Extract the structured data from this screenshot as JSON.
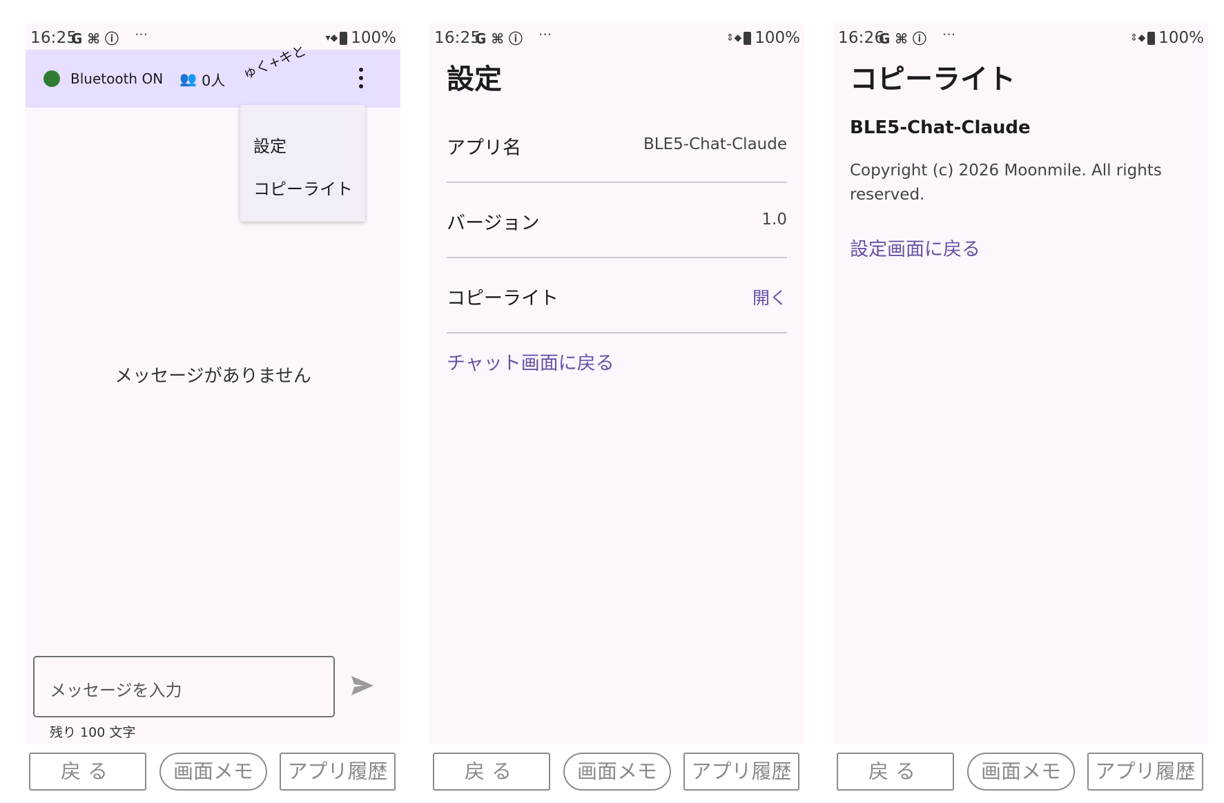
{
  "status_bars": [
    {
      "time": "16:25",
      "icons": "G ⌘ ⓘ",
      "dots": "···",
      "battery": "100%"
    },
    {
      "time": "16:25",
      "icons": "G ⌘ ⓘ",
      "dots": "···",
      "battery": "100%"
    },
    {
      "time": "16:26",
      "icons": "G ⌘ ⓘ",
      "dots": "···",
      "battery": "100%"
    }
  ],
  "chat": {
    "bluetooth_label": "Bluetooth ON",
    "bluetooth_color": "#2e7d32",
    "user_count": "0人",
    "scribble": "ゅく+キと",
    "menu": {
      "settings": "設定",
      "copyright": "コピーライト"
    },
    "empty_message": "メッセージがありません",
    "input_placeholder": "メッセージを入力",
    "remaining": "残り 100 文字"
  },
  "settings": {
    "title": "設定",
    "rows": [
      {
        "label": "アプリ名",
        "value": "BLE5-Chat-Claude"
      },
      {
        "label": "バージョン",
        "value": "1.0"
      },
      {
        "label": "コピーライト",
        "value": "開く"
      }
    ],
    "back_link": "チャット画面に戻る"
  },
  "copyright": {
    "title": "コピーライト",
    "app_name": "BLE5-Chat-Claude",
    "text": "Copyright (c) 2026 Moonmile. All rights reserved.",
    "back_link": "設定画面に戻る"
  },
  "nav": {
    "back": "戻る",
    "memo": "画面メモ",
    "history": "アプリ履歴"
  },
  "accent_color": "#6750a4",
  "topbar_color": "#e8deff"
}
